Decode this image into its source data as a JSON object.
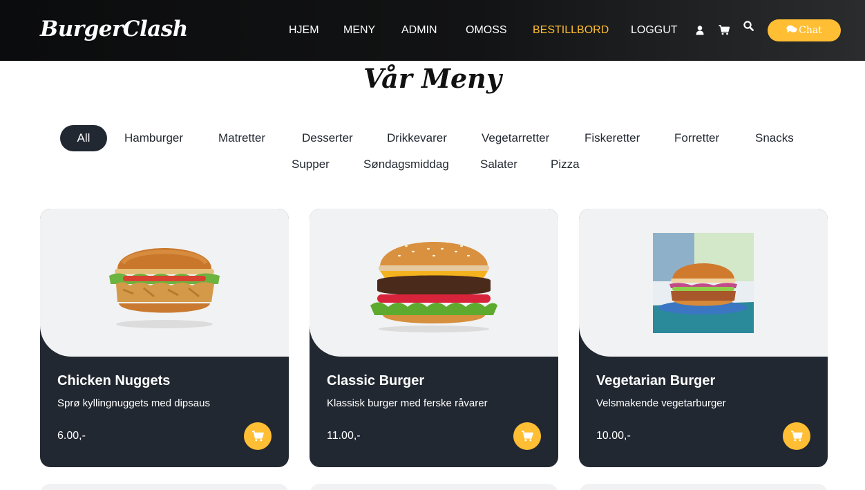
{
  "brand": {
    "name": "BurgerClash"
  },
  "nav": {
    "items": [
      {
        "label": "HJEM"
      },
      {
        "label": "MENY"
      },
      {
        "label": "ADMIN"
      },
      {
        "label": "OMOSS"
      },
      {
        "label": "BESTILLBORD",
        "active": true
      },
      {
        "label": "LOGGUT"
      }
    ],
    "icons": [
      "user-icon",
      "cart-icon",
      "search-icon"
    ],
    "chat_label": "Chat"
  },
  "page": {
    "title": "Vår Meny"
  },
  "filters": [
    {
      "label": "All",
      "active": true
    },
    {
      "label": "Hamburger"
    },
    {
      "label": "Matretter"
    },
    {
      "label": "Desserter"
    },
    {
      "label": "Drikkevarer"
    },
    {
      "label": "Vegetarretter"
    },
    {
      "label": "Fiskeretter"
    },
    {
      "label": "Forretter"
    },
    {
      "label": "Snacks"
    },
    {
      "label": "Supper"
    },
    {
      "label": "Søndagsmiddag"
    },
    {
      "label": "Salater"
    },
    {
      "label": "Pizza"
    }
  ],
  "menu_items": [
    {
      "name": "Chicken Nuggets",
      "description": "Sprø kyllingnuggets med dipsaus",
      "price": "6.00,-"
    },
    {
      "name": "Classic Burger",
      "description": "Klassisk burger med ferske råvarer",
      "price": "11.00,-"
    },
    {
      "name": "Vegetarian Burger",
      "description": "Velsmakende vegetarburger",
      "price": "10.00,-"
    }
  ],
  "colors": {
    "accent": "#ffbe33",
    "dark": "#222831",
    "header": "#0c0d0e",
    "card_bg": "#f1f2f3"
  }
}
